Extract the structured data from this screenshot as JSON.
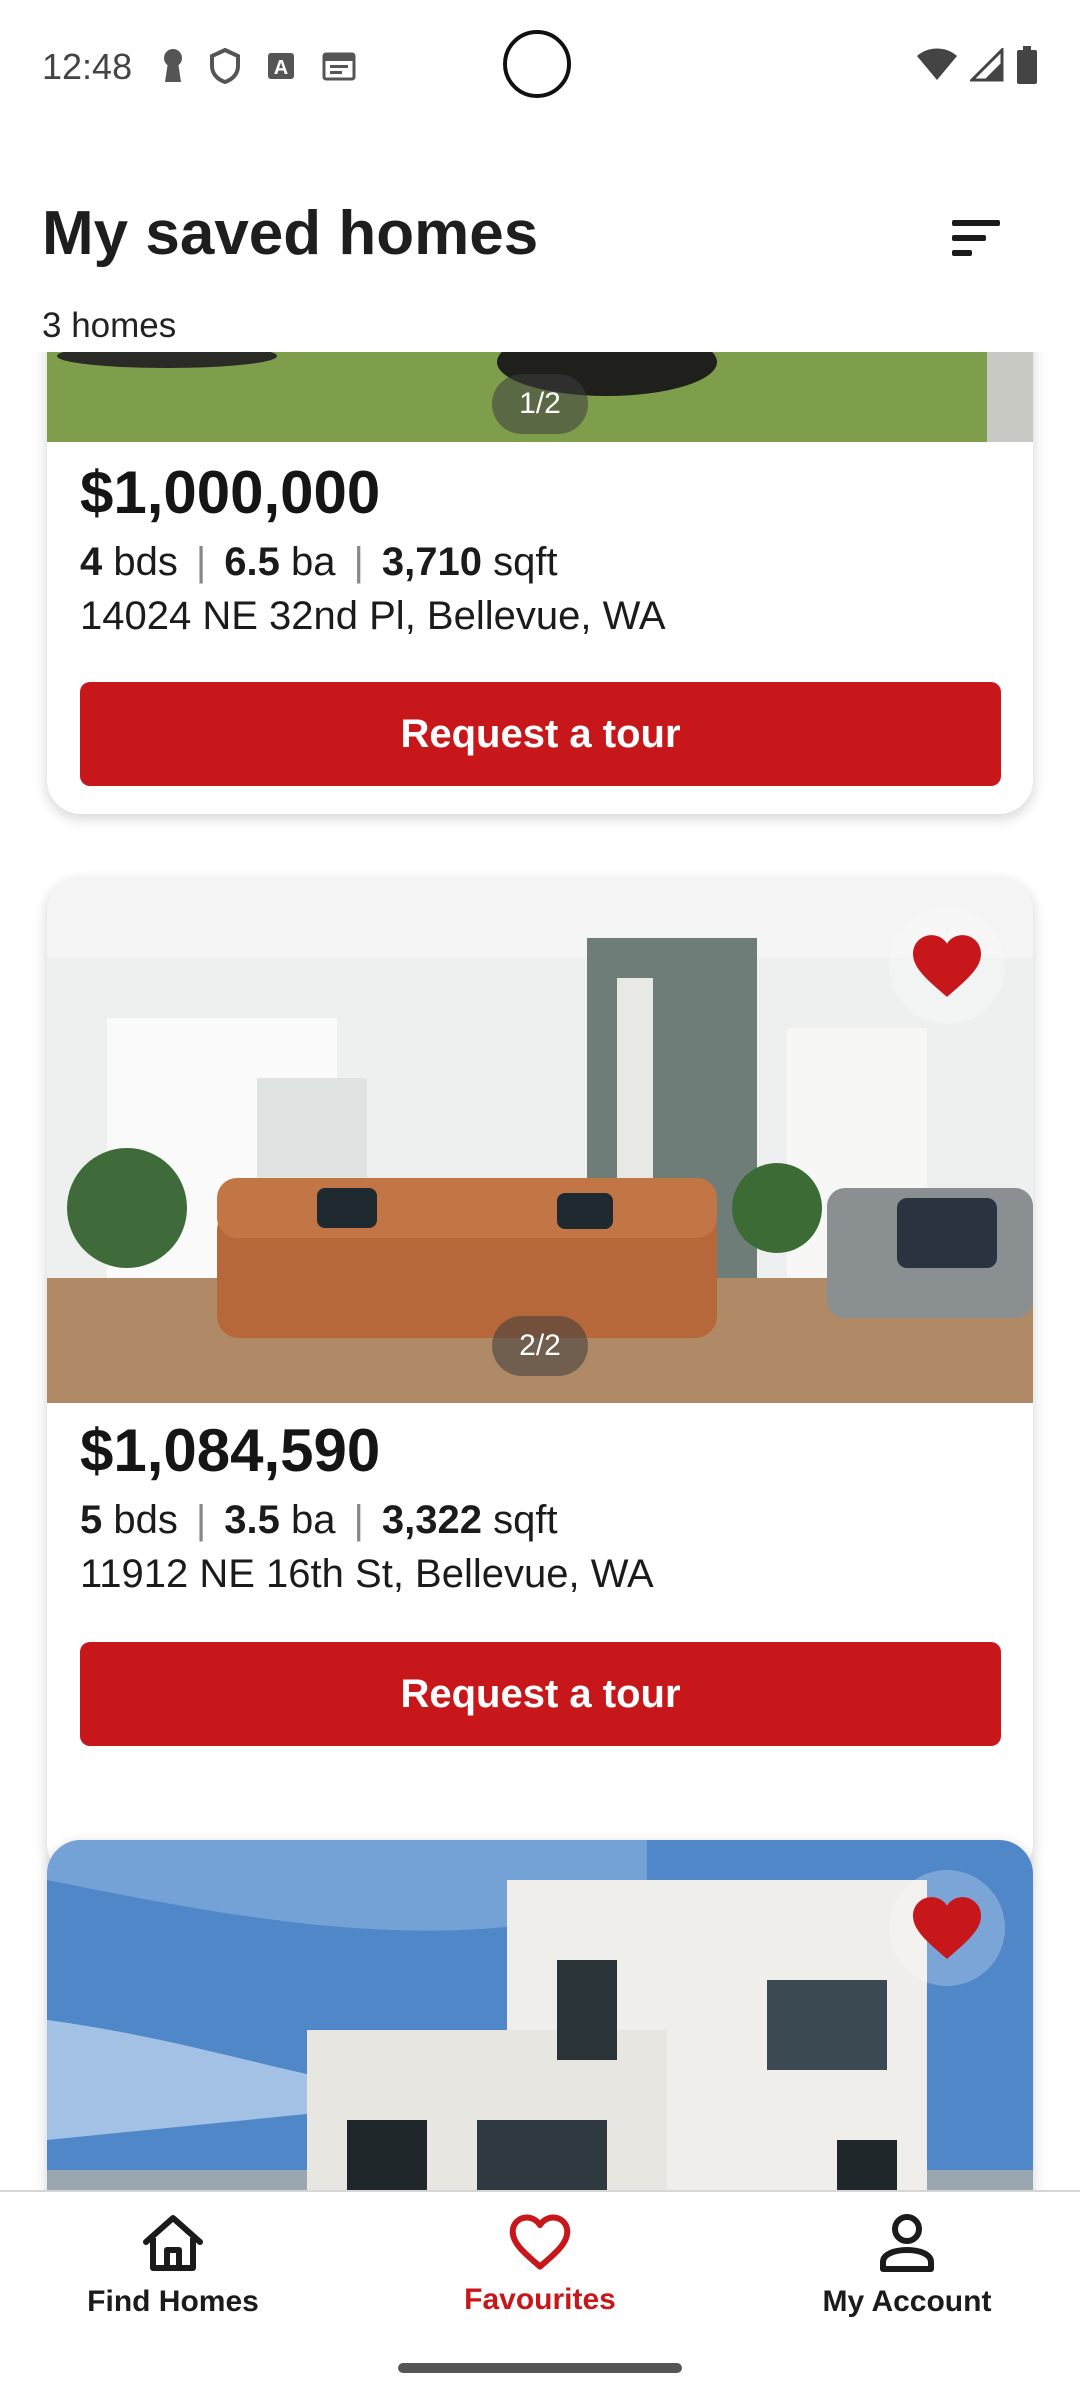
{
  "status_bar": {
    "time": "12:48"
  },
  "header": {
    "title": "My saved homes",
    "count": "3 homes"
  },
  "cards": [
    {
      "photo_counter": "1/2",
      "price": "$1,000,000",
      "beds": "4",
      "beds_unit": "bds",
      "baths": "6.5",
      "baths_unit": "ba",
      "sqft": "3,710",
      "sqft_unit": "sqft",
      "address": "14024 NE 32nd Pl, Bellevue, WA",
      "tour_label": "Request a tour"
    },
    {
      "photo_counter": "2/2",
      "price": "$1,084,590",
      "beds": "5",
      "beds_unit": "bds",
      "baths": "3.5",
      "baths_unit": "ba",
      "sqft": "3,322",
      "sqft_unit": "sqft",
      "address": "11912 NE 16th St, Bellevue, WA",
      "tour_label": "Request a tour"
    }
  ],
  "nav": {
    "items": [
      {
        "label": "Find Homes",
        "icon": "home-icon"
      },
      {
        "label": "Favourites",
        "icon": "heart-outline-icon"
      },
      {
        "label": "My Account",
        "icon": "person-icon"
      }
    ]
  },
  "colors": {
    "accent": "#c8171a",
    "text": "#1b1b1b"
  }
}
